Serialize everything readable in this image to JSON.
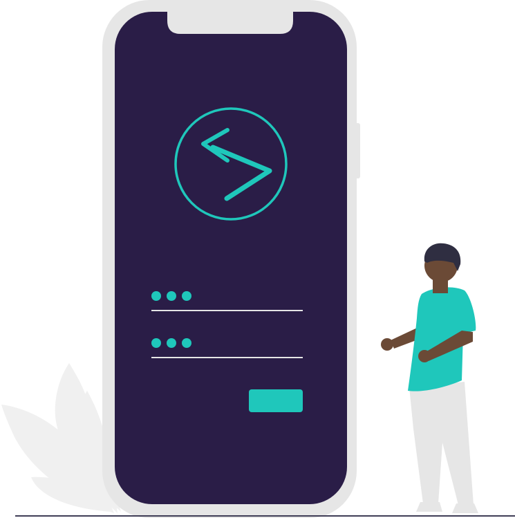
{
  "colors": {
    "background": "#ffffff",
    "phone_frame": "#e6e6e6",
    "phone_screen": "#2a1d47",
    "accent": "#1fc7bb",
    "input_line": "#e6e6e6",
    "leaf": "#f0f0f0",
    "ground": "#3f3d56",
    "skin": "#6b4a36",
    "hair": "#2f2e41",
    "pants": "#e6e6e6",
    "shoes": "#e6e6e6"
  },
  "icons": {
    "logo": "code-arrow-logo-icon",
    "password_mask_1": "password-dots-icon",
    "password_mask_2": "password-dots-icon"
  },
  "login_form": {
    "field_count": 2,
    "mask_dot_count": 3
  }
}
